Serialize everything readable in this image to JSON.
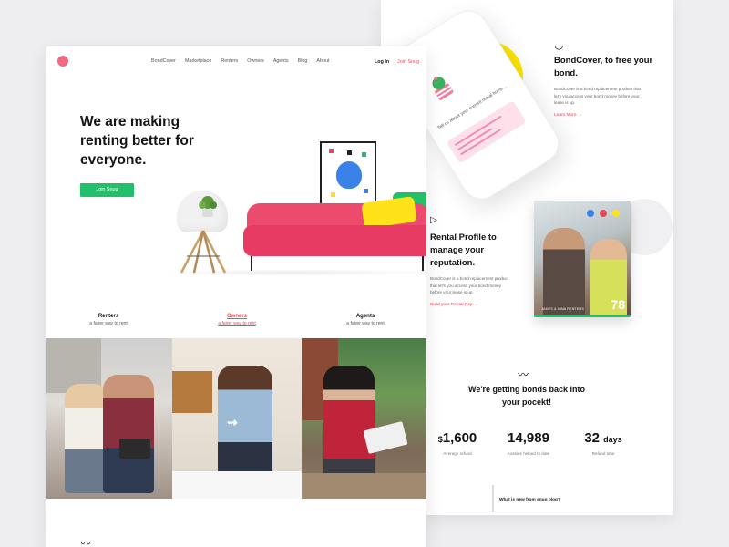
{
  "colors": {
    "accent_pink": "#e8465c",
    "accent_green": "#22c06a",
    "accent_yellow": "#ffe600",
    "accent_blue": "#3a82e8"
  },
  "front": {
    "nav": {
      "logo_icon": "snug-logo-icon",
      "items": [
        "BondCover",
        "Marketplace",
        "Renters",
        "Owners",
        "Agents",
        "Blog",
        "About"
      ],
      "login": "Log In",
      "join": "Join Snug"
    },
    "hero": {
      "title": "We are making renting better for everyone.",
      "cta": "Join Snug"
    },
    "roles": [
      {
        "title": "Renters",
        "subtitle": "a fairer way to rent"
      },
      {
        "title": "Owners",
        "subtitle": "a fairer way to rent"
      },
      {
        "title": "Agents",
        "subtitle": "a fairer way to rent"
      }
    ]
  },
  "back": {
    "phone": {
      "text": "Tell us about your current rental home..."
    },
    "bondcover": {
      "icon": "curve-icon",
      "title": "BondCover, to free your bond.",
      "desc": "BondCover is a bond replacement product that let's you access your bond money before your lease is up.",
      "link": "Learn More"
    },
    "rental_profile": {
      "icon": "play-icon",
      "title": "Rental Profile to manage your reputation.",
      "desc": "BondCover is a bond replacement product that let's you access your bond money before your lease is up.",
      "link": "Build your Rental Rep",
      "card_score": "78",
      "card_name": "JAMES & NINA RENTERS"
    },
    "bonds": {
      "title": "We're getting bonds back into your pocekt!",
      "stats": [
        {
          "prefix": "$",
          "value": "1,600",
          "suffix": "",
          "label": "Average refund"
        },
        {
          "prefix": "",
          "value": "14,989",
          "suffix": "",
          "label": "Aussies helped to date"
        },
        {
          "prefix": "",
          "value": "32",
          "suffix": "days",
          "label": "Refund time"
        }
      ]
    },
    "blog": {
      "title": "What is new from snug blog?"
    }
  }
}
